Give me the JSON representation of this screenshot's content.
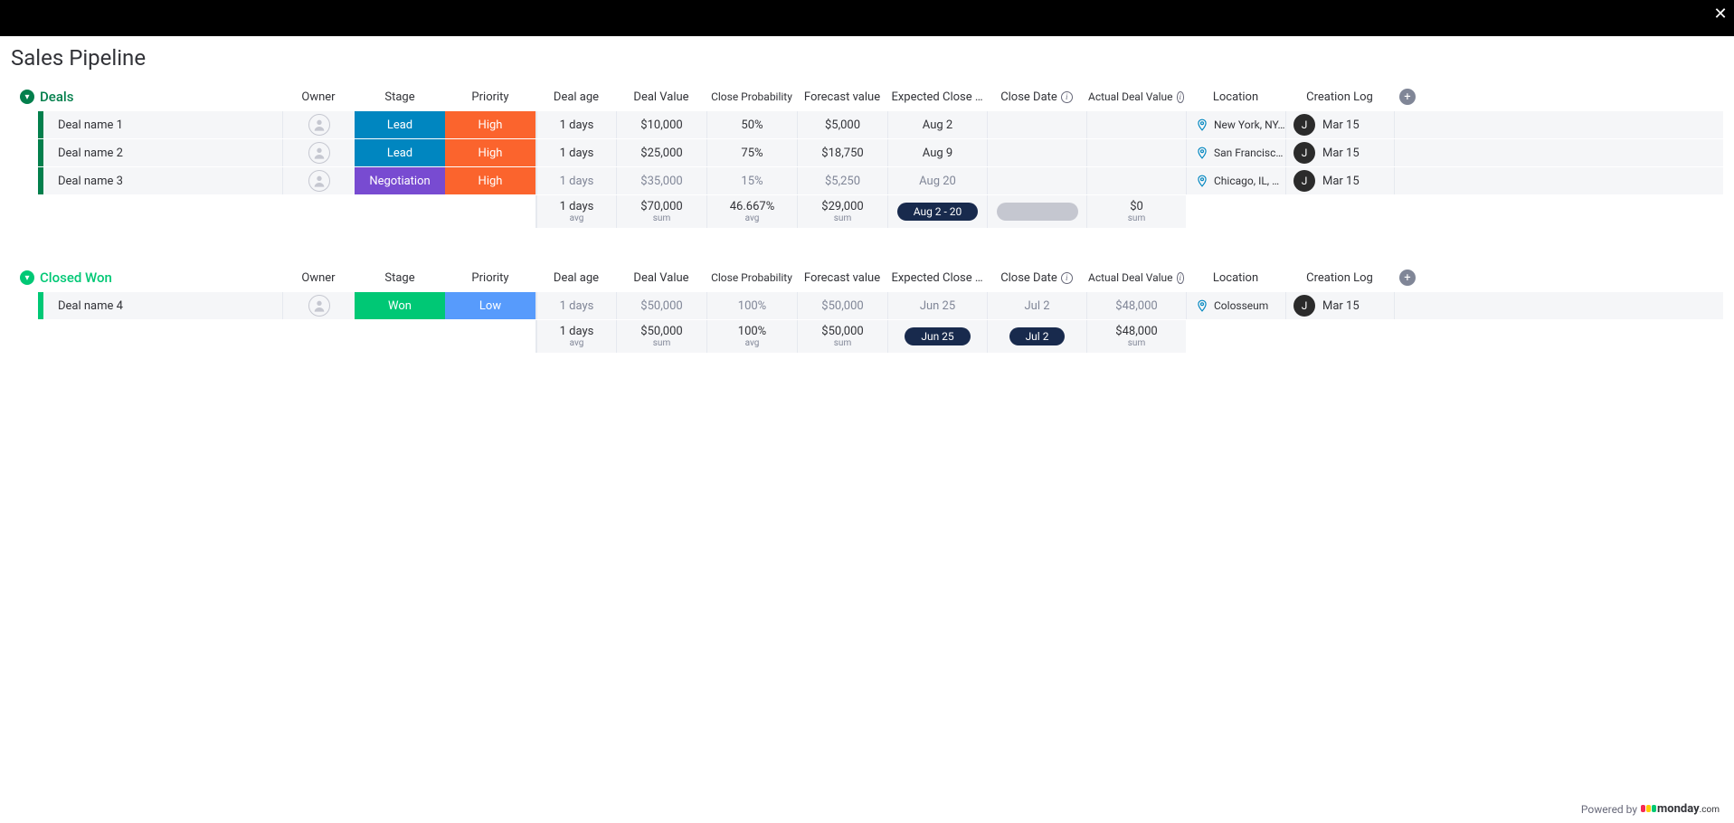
{
  "page_title": "Sales Pipeline",
  "columns": {
    "owner": "Owner",
    "stage": "Stage",
    "priority": "Priority",
    "deal_age": "Deal age",
    "deal_value": "Deal Value",
    "close_prob": "Close Probability",
    "forecast": "Forecast value",
    "expected_close": "Expected Close …",
    "close_date": "Close Date",
    "actual_value": "Actual Deal Value",
    "location": "Location",
    "creation_log": "Creation Log"
  },
  "stage_colors": {
    "Lead": "#0086c0",
    "Negotiation": "#784bd1",
    "Won": "#00c875"
  },
  "priority_colors": {
    "High": "#fb642d",
    "Low": "#579bfc"
  },
  "groups": [
    {
      "id": "deals",
      "title": "Deals",
      "color": "#037f4c",
      "rows": [
        {
          "name": "Deal name 1",
          "stage": "Lead",
          "priority": "High",
          "age": "1 days",
          "value": "$10,000",
          "prob": "50%",
          "forecast": "$5,000",
          "expected": "Aug 2",
          "close_date": "",
          "actual": "",
          "location": "New York, NY, USA",
          "log_initial": "J",
          "log_date": "Mar 15",
          "dim": false
        },
        {
          "name": "Deal name 2",
          "stage": "Lead",
          "priority": "High",
          "age": "1 days",
          "value": "$25,000",
          "prob": "75%",
          "forecast": "$18,750",
          "expected": "Aug 9",
          "close_date": "",
          "actual": "",
          "location": "San Francisco, …",
          "log_initial": "J",
          "log_date": "Mar 15",
          "dim": false
        },
        {
          "name": "Deal name 3",
          "stage": "Negotiation",
          "priority": "High",
          "age": "1 days",
          "value": "$35,000",
          "prob": "15%",
          "forecast": "$5,250",
          "expected": "Aug 20",
          "close_date": "",
          "actual": "",
          "location": "Chicago, IL, USA",
          "log_initial": "J",
          "log_date": "Mar 15",
          "dim": true
        }
      ],
      "summary": {
        "age": "1 days",
        "age_sub": "avg",
        "value": "$70,000",
        "value_sub": "sum",
        "prob": "46.667%",
        "prob_sub": "avg",
        "forecast": "$29,000",
        "forecast_sub": "sum",
        "expected_pill": "Aug 2 - 20",
        "close_pill_type": "grey",
        "actual": "$0",
        "actual_sub": "sum"
      }
    },
    {
      "id": "closed_won",
      "title": "Closed Won",
      "color": "#00c875",
      "rows": [
        {
          "name": "Deal name 4",
          "stage": "Won",
          "priority": "Low",
          "age": "1 days",
          "value": "$50,000",
          "prob": "100%",
          "forecast": "$50,000",
          "expected": "Jun 25",
          "close_date": "Jul 2",
          "actual": "$48,000",
          "location": "Colosseum",
          "log_initial": "J",
          "log_date": "Mar 15",
          "dim": true
        }
      ],
      "summary": {
        "age": "1 days",
        "age_sub": "avg",
        "value": "$50,000",
        "value_sub": "sum",
        "prob": "100%",
        "prob_sub": "avg",
        "forecast": "$50,000",
        "forecast_sub": "sum",
        "expected_pill": "Jun 25",
        "close_pill_type": "pill",
        "close_pill": "Jul 2",
        "actual": "$48,000",
        "actual_sub": "sum"
      }
    }
  ],
  "footer": {
    "powered_by": "Powered by",
    "brand": "monday",
    "suffix": ".com"
  }
}
